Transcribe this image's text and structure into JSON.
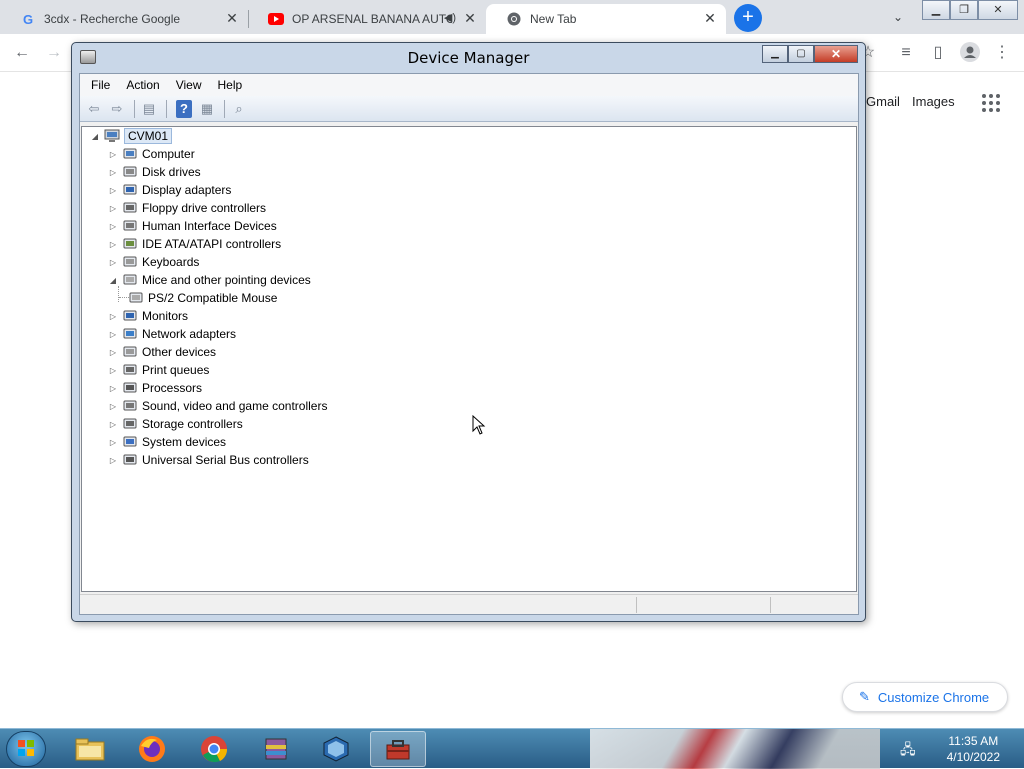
{
  "browser": {
    "tabs": [
      {
        "title": "3cdx - Recherche Google",
        "icon": "google-g-icon",
        "active": false
      },
      {
        "title": "OP ARSENAL BANANA AUTO",
        "icon": "youtube-icon",
        "active": false,
        "audio": true
      },
      {
        "title": "New Tab",
        "icon": "chrome-icon",
        "active": true
      }
    ],
    "links": {
      "gmail": "Gmail",
      "images": "Images"
    },
    "customize_label": "Customize Chrome"
  },
  "device_manager": {
    "title": "Device Manager",
    "menu": [
      "File",
      "Action",
      "View",
      "Help"
    ],
    "root": "CVM01",
    "categories": [
      {
        "label": "Computer",
        "icon": "computer-icon",
        "expanded": false
      },
      {
        "label": "Disk drives",
        "icon": "disk-drive-icon",
        "expanded": false
      },
      {
        "label": "Display adapters",
        "icon": "display-adapter-icon",
        "expanded": false
      },
      {
        "label": "Floppy drive controllers",
        "icon": "floppy-controller-icon",
        "expanded": false
      },
      {
        "label": "Human Interface Devices",
        "icon": "hid-icon",
        "expanded": false
      },
      {
        "label": "IDE ATA/ATAPI controllers",
        "icon": "ide-controller-icon",
        "expanded": false
      },
      {
        "label": "Keyboards",
        "icon": "keyboard-icon",
        "expanded": false
      },
      {
        "label": "Mice and other pointing devices",
        "icon": "mouse-icon",
        "expanded": true
      },
      {
        "label": "PS/2 Compatible Mouse",
        "icon": "mouse-icon",
        "child": true
      },
      {
        "label": "Monitors",
        "icon": "monitor-icon",
        "expanded": false
      },
      {
        "label": "Network adapters",
        "icon": "network-adapter-icon",
        "expanded": false
      },
      {
        "label": "Other devices",
        "icon": "unknown-device-icon",
        "expanded": false
      },
      {
        "label": "Print queues",
        "icon": "printer-icon",
        "expanded": false
      },
      {
        "label": "Processors",
        "icon": "processor-icon",
        "expanded": false
      },
      {
        "label": "Sound, video and game controllers",
        "icon": "speaker-icon",
        "expanded": false
      },
      {
        "label": "Storage controllers",
        "icon": "storage-controller-icon",
        "expanded": false
      },
      {
        "label": "System devices",
        "icon": "system-device-icon",
        "expanded": false
      },
      {
        "label": "Universal Serial Bus controllers",
        "icon": "usb-icon",
        "expanded": false
      }
    ]
  },
  "taskbar": {
    "apps": [
      "file-explorer-icon",
      "firefox-icon",
      "chrome-icon",
      "winrar-icon",
      "virtualbox-icon",
      "toolbox-icon"
    ],
    "time": "11:35 AM",
    "date": "4/10/2022"
  }
}
